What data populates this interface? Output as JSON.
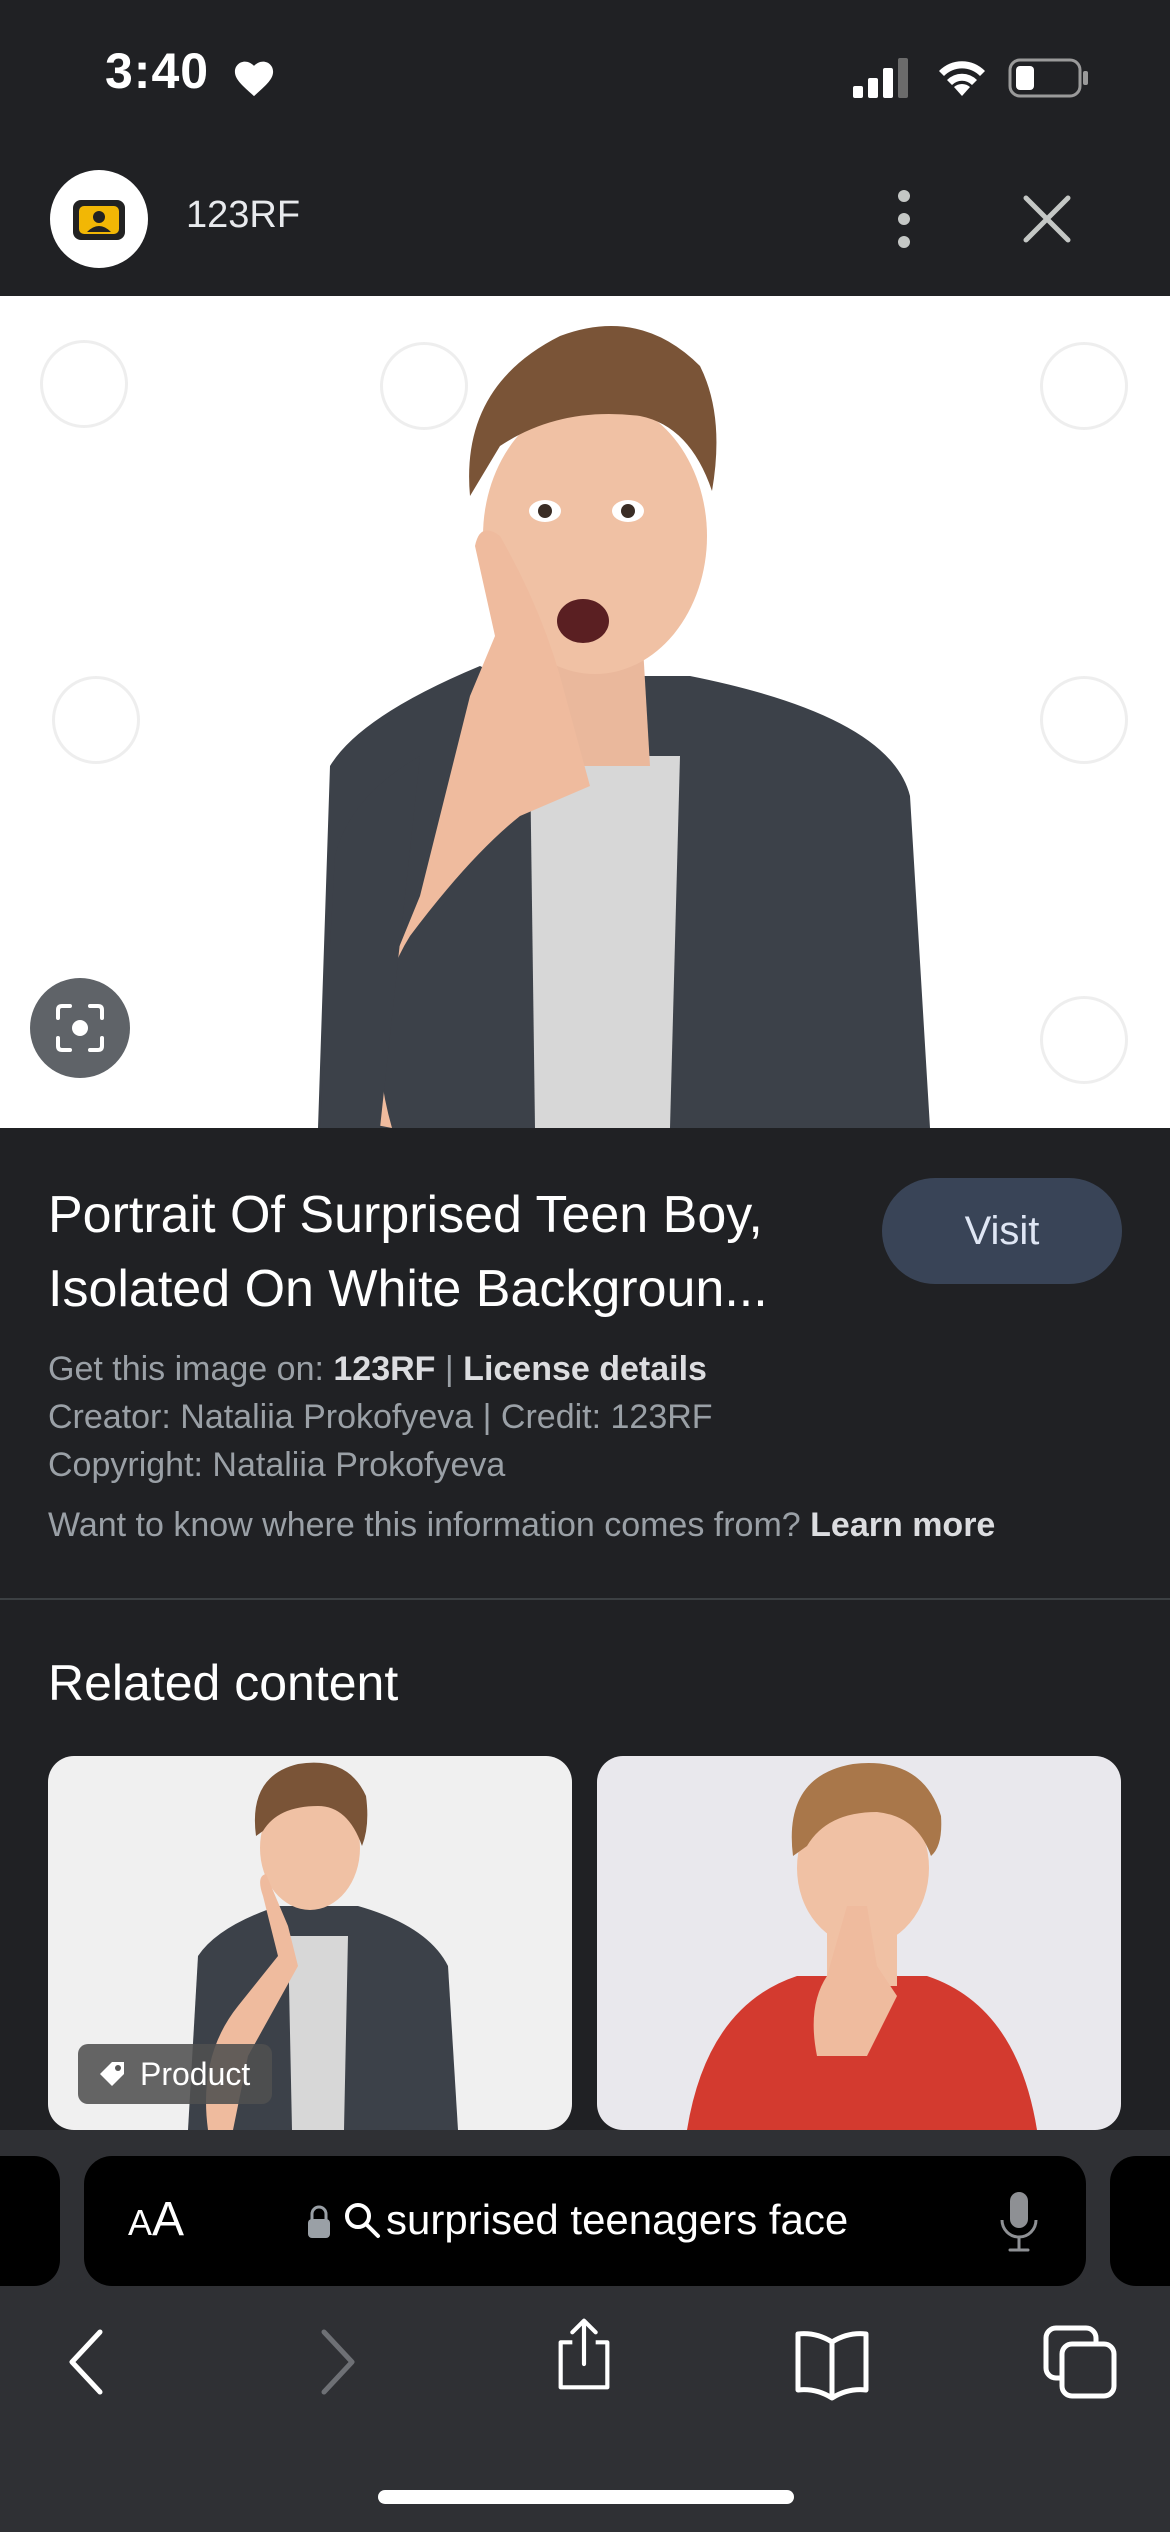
{
  "status_bar": {
    "time": "3:40"
  },
  "header": {
    "site_name": "123RF"
  },
  "result": {
    "title": "Portrait Of Surprised Teen Boy, Isolated On White Backgroun...",
    "visit_label": "Visit",
    "source_prefix": "Get this image on: ",
    "source_name": "123RF",
    "separator": " | ",
    "license_link": "License details",
    "creator_line": "Creator: Nataliia Prokofyeva | Credit: 123RF",
    "copyright_line": "Copyright: Nataliia Prokofyeva",
    "info_question": "Want to know where this information comes from? ",
    "learn_more": "Learn more"
  },
  "related": {
    "title": "Related content",
    "cards": [
      {
        "badge": "Product"
      },
      {
        "badge": ""
      }
    ]
  },
  "browser": {
    "aa_small": "A",
    "aa_large": "A",
    "url_text": "surprised teenagers face"
  },
  "icons": {
    "status": [
      "heart-icon",
      "signal-icon",
      "wifi-icon",
      "battery-icon"
    ],
    "header": [
      "site-logo-icon",
      "more-vert-icon",
      "close-icon"
    ],
    "toolbar": [
      "back-icon",
      "forward-icon",
      "share-icon",
      "bookmarks-icon",
      "tabs-icon"
    ]
  },
  "colors": {
    "background": "#202124",
    "visit_button": "#394457",
    "toolbar": "#2f3034"
  }
}
